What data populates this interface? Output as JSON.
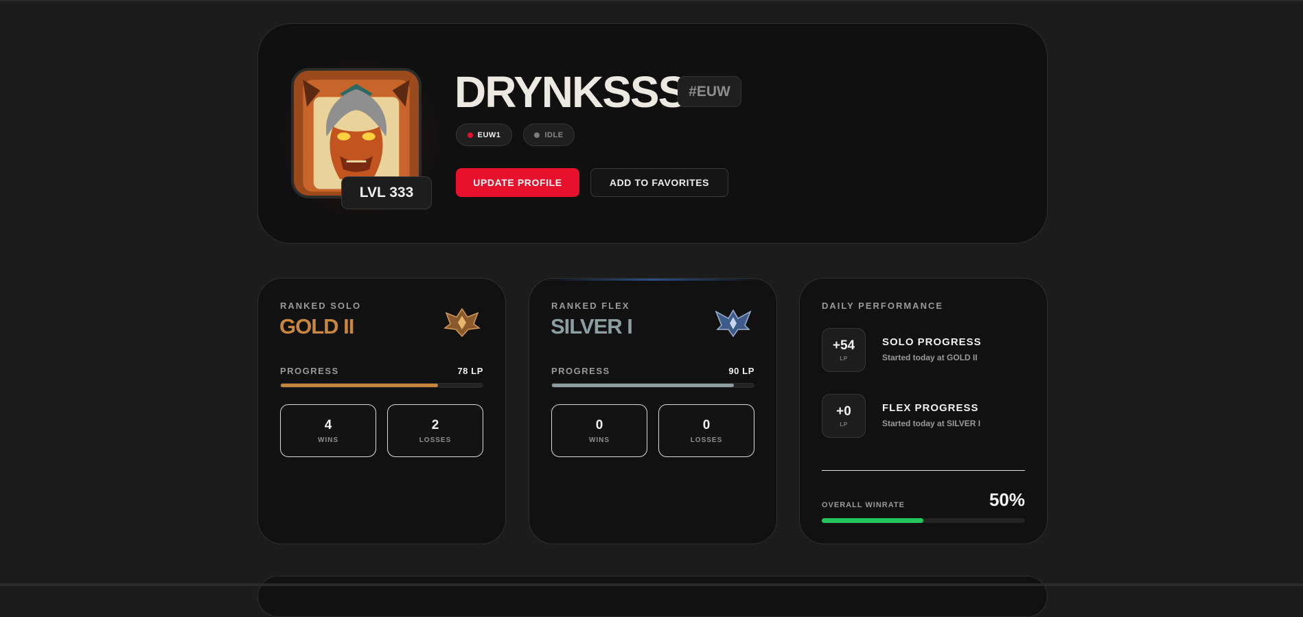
{
  "colors": {
    "accent": "#e8112d",
    "gold": "#c8873c",
    "silver": "#8d9ea3",
    "winrate": "#22c55e",
    "server_dot": "#e8112d",
    "status_dot": "#7d7d7d"
  },
  "profile": {
    "name": "DRYNKSSS",
    "tag": "#EUW",
    "level": "LVL 333",
    "server": "EUW1",
    "status": "IDLE",
    "avatar_icon": "demon-mask-icon",
    "buttons": {
      "update": "UPDATE PROFILE",
      "favorite": "ADD TO FAVORITES"
    }
  },
  "ranked_solo": {
    "queue": "RANKED SOLO",
    "rank": "GOLD II",
    "emblem": "gold-emblem-icon",
    "progress_label": "PROGRESS",
    "lp": "78 LP",
    "progress_fraction": 0.78,
    "wins": "4",
    "wins_label": "WINS",
    "losses": "2",
    "losses_label": "LOSSES"
  },
  "ranked_flex": {
    "queue": "RANKED FLEX",
    "rank": "SILVER I",
    "emblem": "silver-emblem-icon",
    "progress_label": "PROGRESS",
    "lp": "90 LP",
    "progress_fraction": 0.9,
    "wins": "0",
    "wins_label": "WINS",
    "losses": "0",
    "losses_label": "LOSSES"
  },
  "daily": {
    "title": "DAILY PERFORMANCE",
    "solo": {
      "delta": "+54",
      "unit": "LP",
      "title": "SOLO PROGRESS",
      "subtitle": "Started today at GOLD II"
    },
    "flex": {
      "delta": "+0",
      "unit": "LP",
      "title": "FLEX PROGRESS",
      "subtitle": "Started today at SILVER I"
    },
    "winrate_label": "OVERALL WINRATE",
    "winrate": "50%",
    "winrate_fraction": 0.5
  }
}
